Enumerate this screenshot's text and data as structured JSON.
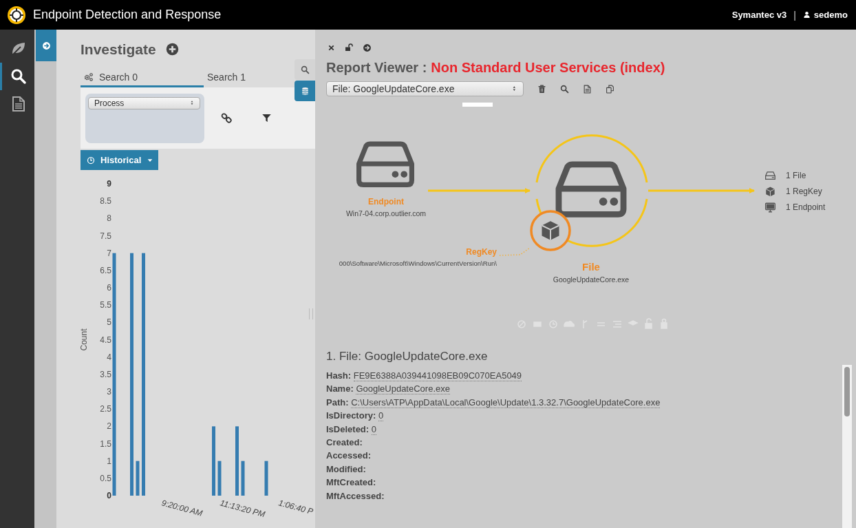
{
  "app": {
    "title": "Endpoint Detection and Response",
    "product": "Symantec v3",
    "separator": "|",
    "user": "sedemo"
  },
  "rail": [
    {
      "kind": "leaf",
      "selected": false
    },
    {
      "kind": "search",
      "selected": true
    },
    {
      "kind": "document",
      "selected": false
    }
  ],
  "investigate": {
    "title": "Investigate",
    "tabs": [
      {
        "label": "Search 0",
        "selected": true
      },
      {
        "label": "Search 1",
        "selected": false
      }
    ],
    "type_select": {
      "value": "Process"
    },
    "time_mode": "Historical",
    "chart_data": {
      "type": "bar",
      "ylabel": "Count",
      "categories": [
        null,
        null,
        null,
        null,
        null,
        null,
        null,
        null,
        "9:20:00 AM",
        null,
        null,
        null,
        null,
        null,
        null,
        null,
        null,
        null,
        "11:13:20 PM",
        null,
        null,
        null,
        null,
        null,
        null,
        null,
        null,
        null,
        "1:06:40 P",
        null,
        null,
        null,
        null,
        null
      ],
      "series": [
        {
          "color": "#2271ab",
          "values": [
            7,
            null,
            null,
            7,
            1,
            7,
            null,
            null,
            null,
            null,
            null,
            null,
            null,
            null,
            null,
            null,
            null,
            2,
            1,
            null,
            null,
            2,
            1,
            null,
            null,
            null,
            1,
            null,
            null,
            null,
            null,
            null,
            null,
            null
          ]
        }
      ],
      "ylim": [
        0,
        9
      ],
      "yticks": [
        0,
        0.5,
        1,
        1.5,
        2,
        2.5,
        3,
        3.5,
        4,
        4.5,
        5,
        5.5,
        6,
        6.5,
        7,
        7.5,
        8,
        8.5,
        9
      ]
    }
  },
  "side_tabs": [
    {
      "kind": "search",
      "selected": false
    },
    {
      "kind": "database",
      "selected": true
    }
  ],
  "report": {
    "title": "Report Viewer :",
    "name": "Non Standard User Services (index)",
    "selector": "File: GoogleUpdateCore.exe",
    "graph": {
      "source": {
        "label": "Endpoint",
        "value": "Win7-04.corp.outlier.com"
      },
      "link": {
        "label": "RegKey",
        "value": "000\\Software\\Microsoft\\Windows\\CurrentVersion\\Run\\"
      },
      "target": {
        "label": "File",
        "value": "GoogleUpdateCore.exe"
      },
      "summary": [
        {
          "kind": "file",
          "text": "1 File"
        },
        {
          "kind": "regkey",
          "text": "1 RegKey"
        },
        {
          "kind": "endpoint",
          "text": "1 Endpoint"
        }
      ]
    },
    "details": {
      "heading": "1. File: GoogleUpdateCore.exe",
      "fields": [
        {
          "label": "Hash:",
          "value": "FE9E6388A039441098EB09C070EA5049"
        },
        {
          "label": "Name:",
          "value": "GoogleUpdateCore.exe"
        },
        {
          "label": "Path:",
          "value": "C:\\Users\\ATP\\AppData\\Local\\Google\\Update\\1.3.32.7\\GoogleUpdateCore.exe"
        },
        {
          "label": "IsDirectory:",
          "value": "0"
        },
        {
          "label": "IsDeleted:",
          "value": "0"
        },
        {
          "label": "Created:"
        },
        {
          "label": "Accessed:"
        },
        {
          "label": "Modified:"
        },
        {
          "label": "MftCreated:"
        },
        {
          "label": "MftAccessed:"
        }
      ]
    }
  }
}
